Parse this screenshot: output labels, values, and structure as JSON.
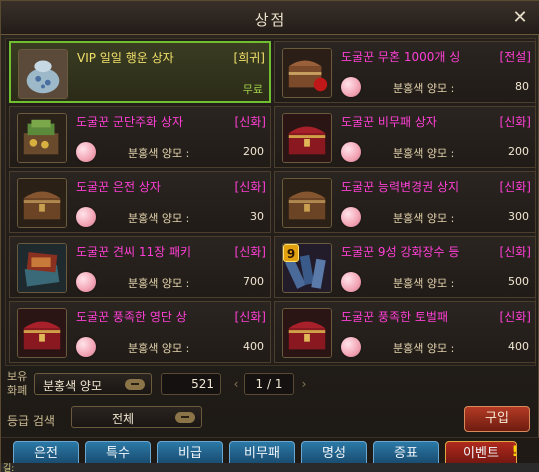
{
  "window": {
    "title": "상점",
    "close": "✕"
  },
  "items": [
    {
      "name": "VIP 일일 행운 상자",
      "grade": "[희귀]",
      "price_label": "",
      "price": "무료",
      "selected": true,
      "icon": "lucky-bag-icon"
    },
    {
      "name": "도굴꾼 무혼 1000개 싱",
      "grade": "[전설]",
      "price_label": "분홍색 양모 :",
      "price": "80",
      "selected": false,
      "icon": "treasure-chest-icon"
    },
    {
      "name": "도굴꾼 군단주화 상자",
      "grade": "[신화]",
      "price_label": "분홍색 양모 :",
      "price": "200",
      "selected": false,
      "icon": "coin-box-icon"
    },
    {
      "name": "도굴꾼 비무패 상자",
      "grade": "[신화]",
      "price_label": "분홍색 양모 :",
      "price": "200",
      "selected": false,
      "icon": "red-chest-icon"
    },
    {
      "name": "도굴꾼 은전 상자",
      "grade": "[신화]",
      "price_label": "분홍색 양모 :",
      "price": "30",
      "selected": false,
      "icon": "wooden-chest-icon"
    },
    {
      "name": "도굴꾼 능력변경권 상지",
      "grade": "[신화]",
      "price_label": "분홍색 양모 :",
      "price": "300",
      "selected": false,
      "icon": "wooden-chest-icon"
    },
    {
      "name": "도굴꾼 견씨 11장 패키",
      "grade": "[신화]",
      "price_label": "분홍색 양모 :",
      "price": "700",
      "selected": false,
      "icon": "card-pack-icon"
    },
    {
      "name": "도굴꾼 9성 강화장수 등",
      "grade": "[신화]",
      "price_label": "분홍색 양모 :",
      "price": "500",
      "selected": false,
      "icon": "scroll-bundle-icon",
      "badge": "9"
    },
    {
      "name": "도굴꾼 풍족한 영단 상",
      "grade": "[신화]",
      "price_label": "분홍색 양모 :",
      "price": "400",
      "selected": false,
      "icon": "red-chest-icon"
    },
    {
      "name": "도굴꾼 풍족한 토벌패",
      "grade": "[신화]",
      "price_label": "분홍색 양모 :",
      "price": "400",
      "selected": false,
      "icon": "red-chest-icon"
    }
  ],
  "footer": {
    "currency_label": "보유 화폐",
    "currency_select": "분홍색 양모",
    "currency_amount": "521",
    "page": "1 / 1",
    "prev": "‹",
    "next": "›",
    "grade_label": "등급 검색",
    "grade_select": "전체",
    "buy": "구입"
  },
  "tabs": [
    "은전",
    "특수",
    "비급",
    "비무패",
    "명성",
    "증표",
    "이벤트"
  ],
  "event_marker": "!",
  "bottom_strip": "길:"
}
